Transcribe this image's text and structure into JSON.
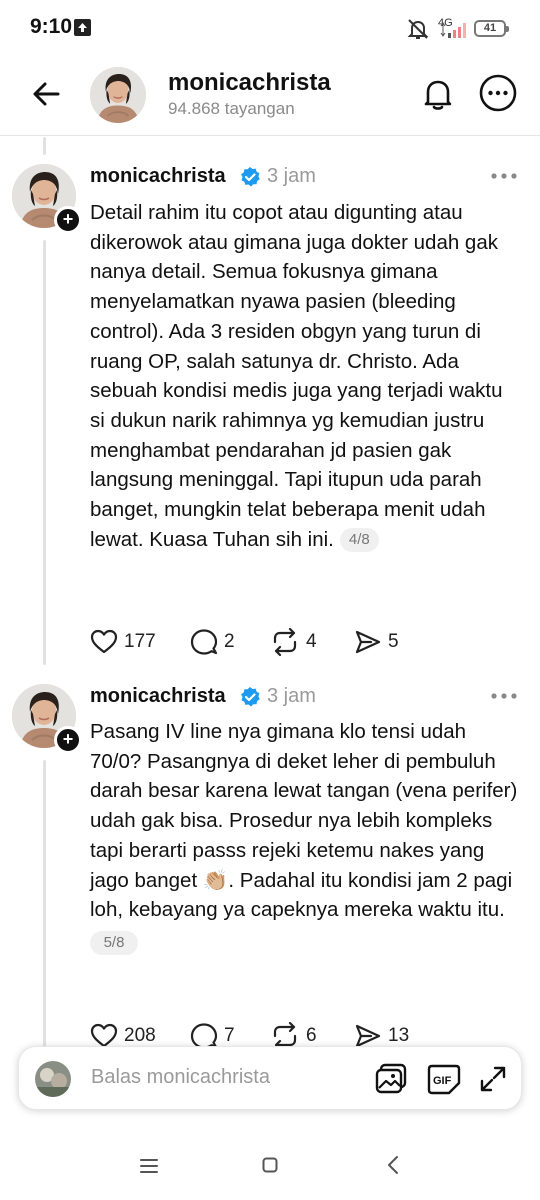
{
  "status_bar": {
    "time": "9:10",
    "network": "4G",
    "battery": "41"
  },
  "header": {
    "username": "monicachrista",
    "views": "94.868 tayangan",
    "icons": [
      "back-arrow-icon",
      "bell-icon",
      "more-circle-icon"
    ]
  },
  "posts": [
    {
      "author": "monicachrista",
      "time": "3 jam",
      "text": "Detail rahim itu copot atau digunting atau dikerowok atau gimana juga dokter udah gak nanya detail. Semua fokusnya gimana menyelamatkan nyawa pasien (bleeding control). Ada 3 residen obgyn yang turun di ruang OP, salah satunya dr. Christo. Ada sebuah kondisi medis juga yang terjadi waktu si dukun narik rahimnya yg kemudian justru menghambat pendarahan jd pasien gak langsung meninggal. Tapi itupun uda parah banget, mungkin telat beberapa menit udah lewat. Kuasa Tuhan sih ini.",
      "page": "4/8",
      "likes": "177",
      "replies": "2",
      "reposts": "4",
      "shares": "5"
    },
    {
      "author": "monicachrista",
      "time": "3 jam",
      "text": "Pasang IV line nya gimana klo tensi udah 70/0? Pasangnya di deket leher di pembuluh darah besar karena lewat tangan (vena perifer) udah gak bisa. Prosedur nya lebih kompleks tapi berarti passs rejeki ketemu nakes yang jago banget 👏🏼. Padahal itu kondisi jam 2 pagi loh, kebayang ya capeknya mereka waktu itu.",
      "page": "5/8",
      "likes": "208",
      "replies": "7",
      "reposts": "6",
      "shares": "13"
    }
  ],
  "reply_bar": {
    "placeholder": "Balas monicachrista",
    "icons": [
      "image-icon",
      "gif-icon",
      "expand-icon"
    ]
  },
  "nav_bar": {
    "icons": [
      "menu-icon",
      "home-icon",
      "back-icon"
    ]
  },
  "colors": {
    "verified": "#1d9bf0",
    "muted": "#999999",
    "line": "#e2e2e2"
  }
}
